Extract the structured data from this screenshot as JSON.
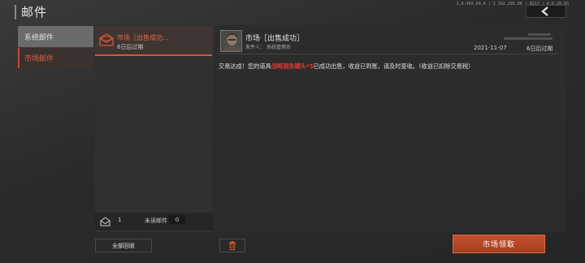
{
  "header": {
    "title": "邮件",
    "version": "1.0.460.60.4 | 1 192.295.88 | 8217 | 8.0.28.03",
    "back_icon": "chevron-left-icon"
  },
  "categories": [
    {
      "label": "系统邮件",
      "selected": false
    },
    {
      "label": "市场邮件",
      "selected": true
    }
  ],
  "mail_list": [
    {
      "title": "市场［出售成功...",
      "expiry": "6日后过期",
      "icon": "mail-open-icon",
      "selected": true
    }
  ],
  "list_footer": {
    "icon": "mail-stack-icon",
    "total": "1",
    "unread_label": "未读邮件",
    "unread_count": "0"
  },
  "collect_all_label": "全部回收",
  "detail": {
    "title": "市场［出售成功］",
    "sender_label": "发件人：",
    "sender": "系统管理员",
    "date": "2021-11-07",
    "expiry": "6日后过期",
    "body_prefix": "交易达成！您的道具",
    "item_name": "战略钢鱼罐头*5",
    "body_suffix": "已成功出售，收益已到账，请及时查收。（收益已扣除交易税）"
  },
  "delete_icon": "trash-icon",
  "claim_button_label": "市场领取",
  "colors": {
    "accent": "#c4512e",
    "highlight_text": "#e0352c",
    "selected_tab_text": "#e0603c"
  }
}
